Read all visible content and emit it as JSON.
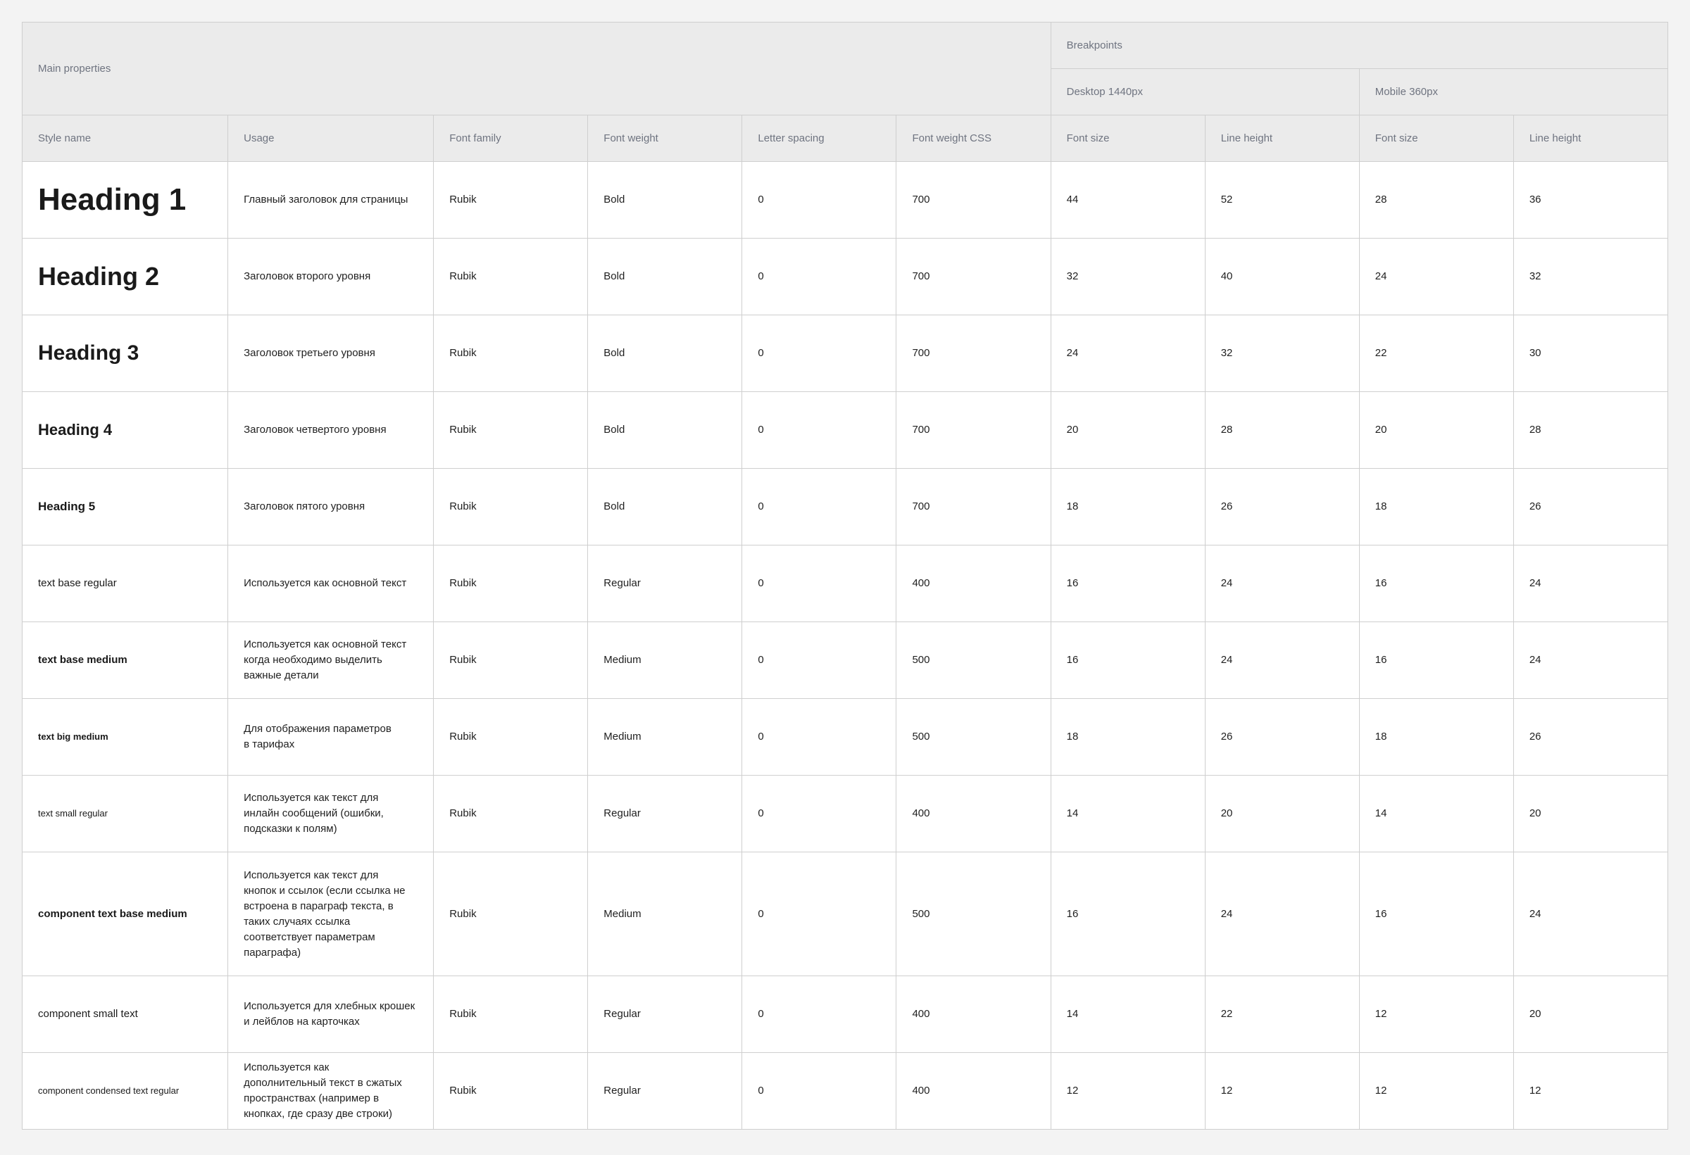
{
  "header": {
    "main_properties": "Main properties",
    "breakpoints": "Breakpoints",
    "desktop": "Desktop 1440px",
    "mobile": "Mobile 360px",
    "columns": [
      "Style name",
      "Usage",
      "Font family",
      "Font weight",
      "Letter spacing",
      "Font weight CSS",
      "Font size",
      "Line height",
      "Font size",
      "Line height"
    ]
  },
  "rows": [
    {
      "style": "Heading 1",
      "usage": "Главный заголовок для страницы",
      "family": "Rubik",
      "weight": "Bold",
      "spacing": "0",
      "css": "700",
      "d_size": "44",
      "d_lh": "52",
      "m_size": "28",
      "m_lh": "36"
    },
    {
      "style": "Heading 2",
      "usage": "Заголовок второго уровня",
      "family": "Rubik",
      "weight": "Bold",
      "spacing": "0",
      "css": "700",
      "d_size": "32",
      "d_lh": "40",
      "m_size": "24",
      "m_lh": "32"
    },
    {
      "style": "Heading 3",
      "usage": "Заголовок третьего уровня",
      "family": "Rubik",
      "weight": "Bold",
      "spacing": "0",
      "css": "700",
      "d_size": "24",
      "d_lh": "32",
      "m_size": "22",
      "m_lh": "30"
    },
    {
      "style": "Heading 4",
      "usage": "Заголовок четвертого уровня",
      "family": "Rubik",
      "weight": "Bold",
      "spacing": "0",
      "css": "700",
      "d_size": "20",
      "d_lh": "28",
      "m_size": "20",
      "m_lh": "28"
    },
    {
      "style": "Heading 5",
      "usage": "Заголовок пятого уровня",
      "family": "Rubik",
      "weight": "Bold",
      "spacing": "0",
      "css": "700",
      "d_size": "18",
      "d_lh": "26",
      "m_size": "18",
      "m_lh": "26"
    },
    {
      "style": "text base regular",
      "usage": "Используется как основной текст",
      "family": "Rubik",
      "weight": "Regular",
      "spacing": "0",
      "css": "400",
      "d_size": "16",
      "d_lh": "24",
      "m_size": "16",
      "m_lh": "24"
    },
    {
      "style": "text base medium",
      "usage": "Используется как основной текст\nкогда необходимо выделить\nважные детали",
      "family": "Rubik",
      "weight": "Medium",
      "spacing": "0",
      "css": "500",
      "d_size": "16",
      "d_lh": "24",
      "m_size": "16",
      "m_lh": "24"
    },
    {
      "style": "text big medium",
      "usage": "Для отображения параметров\nв тарифах",
      "family": "Rubik",
      "weight": "Medium",
      "spacing": "0",
      "css": "500",
      "d_size": "18",
      "d_lh": "26",
      "m_size": "18",
      "m_lh": "26"
    },
    {
      "style": "text small regular",
      "usage": "Используется как текст для\nинлайн сообщений (ошибки,\nподсказки к полям)",
      "family": "Rubik",
      "weight": "Regular",
      "spacing": "0",
      "css": "400",
      "d_size": "14",
      "d_lh": "20",
      "m_size": "14",
      "m_lh": "20"
    },
    {
      "style": "component text base medium",
      "usage": "Используется как текст для\nкнопок и ссылок (если ссылка не\nвстроена в параграф текста, в\nтаких случаях ссылка\nсоответствует параметрам\nпараграфа)",
      "family": "Rubik",
      "weight": "Medium",
      "spacing": "0",
      "css": "500",
      "d_size": "16",
      "d_lh": "24",
      "m_size": "16",
      "m_lh": "24"
    },
    {
      "style": "component small text",
      "usage": "Используется для хлебных крошек\nи лейблов на карточках",
      "family": "Rubik",
      "weight": "Regular",
      "spacing": "0",
      "css": "400",
      "d_size": "14",
      "d_lh": "22",
      "m_size": "12",
      "m_lh": "20"
    },
    {
      "style": "component condensed text regular",
      "usage": "Используется как\nдополнительный текст в сжатых\nпространствах (например в\nкнопках, где сразу две строки)",
      "family": "Rubik",
      "weight": "Regular",
      "spacing": "0",
      "css": "400",
      "d_size": "12",
      "d_lh": "12",
      "m_size": "12",
      "m_lh": "12"
    }
  ]
}
